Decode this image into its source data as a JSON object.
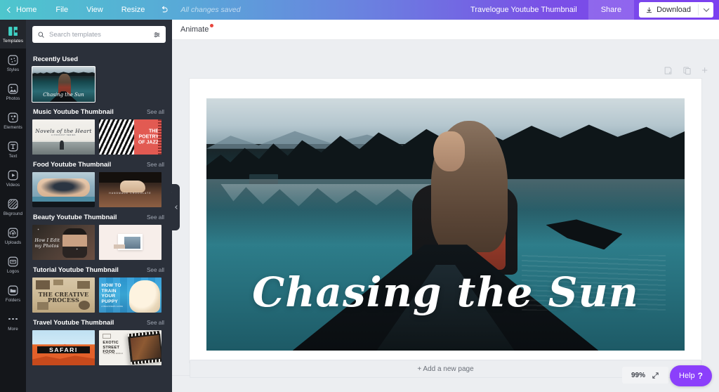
{
  "header": {
    "home_label": "Home",
    "menu": [
      "File",
      "View",
      "Resize"
    ],
    "undo_icon": "undo-arrow-icon",
    "status": "All changes saved",
    "doc_title": "Travelogue Youtube Thumbnail",
    "share_label": "Share",
    "download_label": "Download",
    "download_icon": "download-icon",
    "caret_icon": "chevron-down-icon",
    "gradient_start": "#4ec6cd",
    "gradient_end": "#7b3ff0"
  },
  "rail": {
    "items": [
      {
        "label": "Templates",
        "icon": "templates-icon",
        "active": true
      },
      {
        "label": "Styles",
        "icon": "palette-icon",
        "active": false
      },
      {
        "label": "Photos",
        "icon": "photo-icon",
        "active": false
      },
      {
        "label": "Elements",
        "icon": "shapes-icon",
        "active": false
      },
      {
        "label": "Text",
        "icon": "text-icon",
        "active": false
      },
      {
        "label": "Videos",
        "icon": "video-play-icon",
        "active": false
      },
      {
        "label": "Bkground",
        "icon": "background-grid-icon",
        "active": false
      },
      {
        "label": "Uploads",
        "icon": "upload-cloud-icon",
        "active": false
      },
      {
        "label": "Logos",
        "icon": "logos-icon",
        "active": false
      },
      {
        "label": "Folders",
        "icon": "folder-icon",
        "active": false
      },
      {
        "label": "More",
        "icon": "ellipsis-icon",
        "active": false
      }
    ]
  },
  "panel": {
    "search": {
      "placeholder": "Search templates",
      "value": "",
      "search_icon": "search-icon",
      "filter_icon": "filter-sliders-icon"
    },
    "recently_used": {
      "title": "Recently Used",
      "thumb_caption": "Chasing the Sun"
    },
    "see_all_label": "See all",
    "arrow_icon": "chevron-right-icon",
    "sections": [
      {
        "title": "Music Youtube Thumbnail",
        "thumbs": [
          {
            "art": "novels",
            "title": "Novels of the Heart",
            "sub": "A PODCAST SERIES"
          },
          {
            "art": "jazz",
            "title": "THE POETRY OF JAZZ"
          }
        ]
      },
      {
        "title": "Food Youtube Thumbnail",
        "thumbs": [
          {
            "art": "berry",
            "title": ""
          },
          {
            "art": "choc",
            "title": "HANDMADE CHOCOLATE"
          }
        ]
      },
      {
        "title": "Beauty Youtube Thumbnail",
        "thumbs": [
          {
            "art": "beauty",
            "title": "How I Edit my Photos"
          },
          {
            "art": "pink",
            "title": ""
          }
        ]
      },
      {
        "title": "Tutorial Youtube Thumbnail",
        "thumbs": [
          {
            "art": "creative",
            "title": "THE CREATIVE PROCESS"
          },
          {
            "art": "puppy",
            "title": "HOW TO TRAIN YOUR PUPPY",
            "sub": "A BEGINNERS GUIDE"
          }
        ]
      },
      {
        "title": "Travel Youtube Thumbnail",
        "thumbs": [
          {
            "art": "safari",
            "title": "SAFARI"
          },
          {
            "art": "exotic",
            "title": "EXOTIC STREET FOOD",
            "sub": "TRAVEL THE WORLD"
          }
        ]
      }
    ],
    "collapse_icon": "chevron-left-icon"
  },
  "editor": {
    "animate_label": "Animate",
    "animate_badge": "new-dot",
    "page_tools": [
      {
        "icon": "notes-page-icon"
      },
      {
        "icon": "duplicate-page-icon"
      },
      {
        "icon": "add-page-plus-icon"
      }
    ],
    "canvas": {
      "headline": "Chasing the Sun"
    },
    "add_page_label": "+ Add a new page",
    "zoom_value": "99%",
    "expand_icon": "expand-arrows-icon",
    "help_label": "Help",
    "help_mark": "?",
    "help_color": "#8b3ffb"
  }
}
